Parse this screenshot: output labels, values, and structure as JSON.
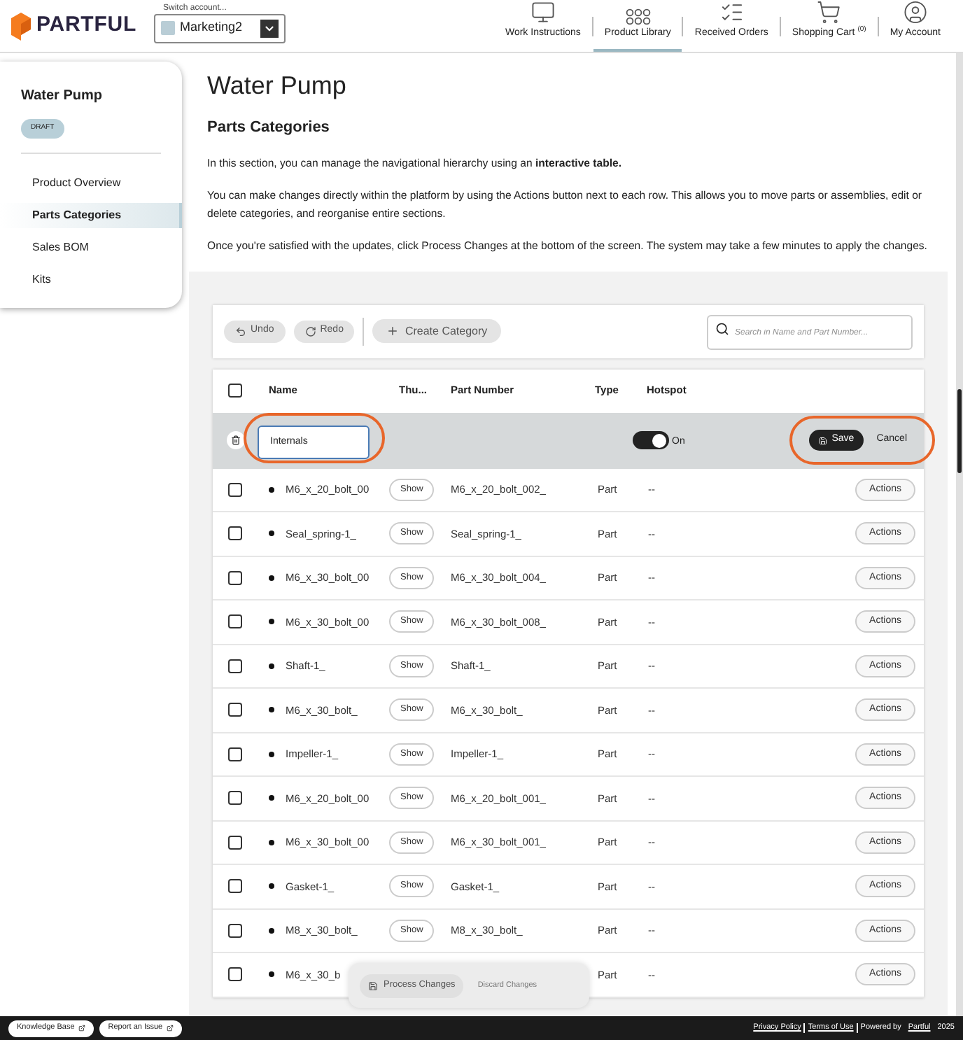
{
  "brand": {
    "name": "PARTFUL"
  },
  "account_switch": {
    "label": "Switch account...",
    "value": "Marketing2"
  },
  "nav": [
    {
      "label": "Work Instructions",
      "selected": false
    },
    {
      "label": "Product Library",
      "selected": true
    },
    {
      "label": "Received Orders",
      "selected": false
    },
    {
      "label": "Shopping Cart",
      "count": "(0)",
      "selected": false
    },
    {
      "label": "My Account",
      "selected": false
    }
  ],
  "sidebar": {
    "title": "Water Pump",
    "badge": "DRAFT",
    "items": [
      {
        "label": "Product Overview",
        "selected": false
      },
      {
        "label": "Parts Categories",
        "selected": true
      },
      {
        "label": "Sales BOM",
        "selected": false
      },
      {
        "label": "Kits",
        "selected": false
      }
    ]
  },
  "page": {
    "title": "Water Pump",
    "heading": "Parts Categories",
    "paragraphs": [
      "In this section, you can manage the navigational hierarchy using an **interactive table.**",
      "You can make changes directly within the platform by using the Actions button next to each row. This allows you to move parts or assemblies, edit or delete categories, and reorganise entire sections.",
      "Once you're satisfied with the updates, click Process Changes at the bottom of the screen. The system may take a few minutes to apply the changes."
    ]
  },
  "toolbar": {
    "undo": "Undo",
    "redo": "Redo",
    "create": "Create Category",
    "search": {
      "placeholder": "Search in Name and Part Number..."
    }
  },
  "table": {
    "all_checked": false,
    "columns": [
      "Name",
      "Thu...",
      "Part Number",
      "Type",
      "Hotspot"
    ],
    "edit_row": {
      "value": "Internals",
      "hotspot_on": true,
      "hotspot_label": "On",
      "save": "Save",
      "cancel": "Cancel"
    },
    "rows": [
      {
        "name": "M6_x_20_bolt_00",
        "thumb": "Show",
        "part_number": "M6_x_20_bolt_002_",
        "type": "Part",
        "hotspot": "--",
        "action": "Actions",
        "checked": false
      },
      {
        "name": "Seal_spring-1_",
        "thumb": "Show",
        "part_number": "Seal_spring-1_",
        "type": "Part",
        "hotspot": "--",
        "action": "Actions",
        "checked": false
      },
      {
        "name": "M6_x_30_bolt_00",
        "thumb": "Show",
        "part_number": "M6_x_30_bolt_004_",
        "type": "Part",
        "hotspot": "--",
        "action": "Actions",
        "checked": false
      },
      {
        "name": "M6_x_30_bolt_00",
        "thumb": "Show",
        "part_number": "M6_x_30_bolt_008_",
        "type": "Part",
        "hotspot": "--",
        "action": "Actions",
        "checked": false
      },
      {
        "name": "Shaft-1_",
        "thumb": "Show",
        "part_number": "Shaft-1_",
        "type": "Part",
        "hotspot": "--",
        "action": "Actions",
        "checked": false
      },
      {
        "name": "M6_x_30_bolt_",
        "thumb": "Show",
        "part_number": "M6_x_30_bolt_",
        "type": "Part",
        "hotspot": "--",
        "action": "Actions",
        "checked": false
      },
      {
        "name": "Impeller-1_",
        "thumb": "Show",
        "part_number": "Impeller-1_",
        "type": "Part",
        "hotspot": "--",
        "action": "Actions",
        "checked": false
      },
      {
        "name": "M6_x_20_bolt_00",
        "thumb": "Show",
        "part_number": "M6_x_20_bolt_001_",
        "type": "Part",
        "hotspot": "--",
        "action": "Actions",
        "checked": false
      },
      {
        "name": "M6_x_30_bolt_00",
        "thumb": "Show",
        "part_number": "M6_x_30_bolt_001_",
        "type": "Part",
        "hotspot": "--",
        "action": "Actions",
        "checked": false
      },
      {
        "name": "Gasket-1_",
        "thumb": "Show",
        "part_number": "Gasket-1_",
        "type": "Part",
        "hotspot": "--",
        "action": "Actions",
        "checked": false
      },
      {
        "name": "M8_x_30_bolt_",
        "thumb": "Show",
        "part_number": "M8_x_30_bolt_",
        "type": "Part",
        "hotspot": "--",
        "action": "Actions",
        "checked": false
      },
      {
        "name": "M6_x_30_b",
        "type": "Part",
        "hotspot": "--",
        "action": "Actions",
        "checked": false
      }
    ]
  },
  "process_bar": {
    "process": "Process Changes",
    "discard": "Discard Changes"
  },
  "footer": {
    "links": [
      "Knowledge Base",
      "Report an Issue"
    ],
    "legal": [
      "Privacy Policy",
      "Terms of Use"
    ],
    "powered": "Powered by",
    "brand": "Partful",
    "year": "2025"
  }
}
